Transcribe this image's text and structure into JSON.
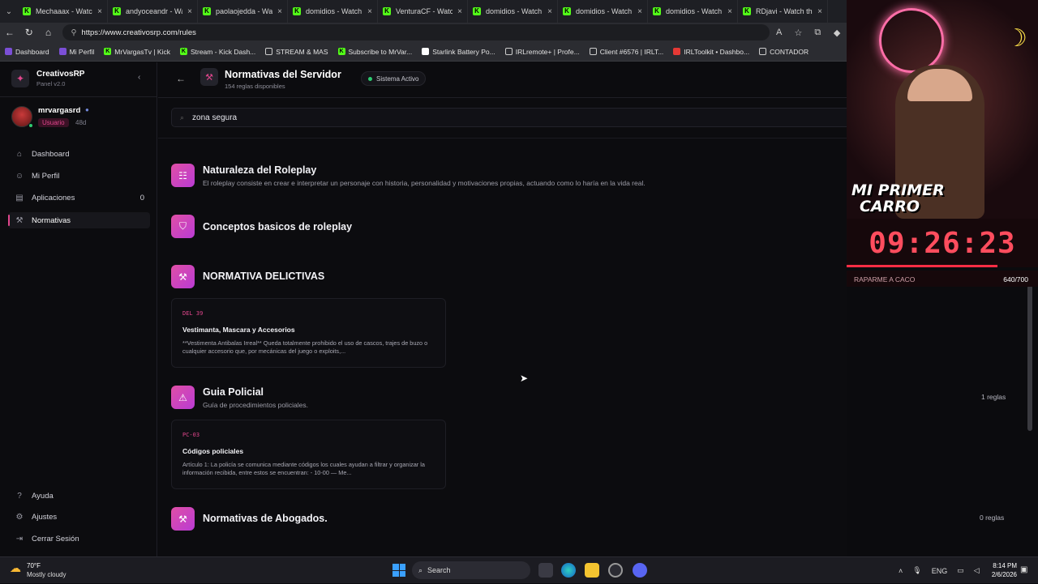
{
  "browser": {
    "tabs": [
      {
        "label": "Mechaaax - Watch t"
      },
      {
        "label": "andyoceandr - Watc"
      },
      {
        "label": "paolaojedda - Watc"
      },
      {
        "label": "domidios - Watch t"
      },
      {
        "label": "VenturaCF - Watch t"
      },
      {
        "label": "domidios - Watch t"
      },
      {
        "label": "domidios - Watch t"
      },
      {
        "label": "domidios - Watch t"
      },
      {
        "label": "RDjavi - Watch the"
      }
    ],
    "url": "https://www.creativosrp.com/rules",
    "bookmarks": [
      {
        "label": "Dashboard",
        "icon": "purple"
      },
      {
        "label": "Mi Perfil",
        "icon": "purple"
      },
      {
        "label": "MrVargasTv | Kick",
        "icon": "kick"
      },
      {
        "label": "Stream - Kick Dash...",
        "icon": "kick"
      },
      {
        "label": "STREAM & MAS",
        "icon": "folder"
      },
      {
        "label": "Subscribe to MrVar...",
        "icon": "kick"
      },
      {
        "label": "Starlink Battery Po...",
        "icon": "white"
      },
      {
        "label": "IRLremote+ | Profe...",
        "icon": "globe"
      },
      {
        "label": "Client #6576 | IRLT...",
        "icon": "folder"
      },
      {
        "label": "IRLToolkit • Dashbo...",
        "icon": "red"
      },
      {
        "label": "CONTADOR",
        "icon": "globe"
      }
    ]
  },
  "sidebar": {
    "brand": "CreativosRP",
    "version": "Panel v2.0",
    "user": {
      "name": "mrvargasrd",
      "role": "Usuario",
      "age": "48d"
    },
    "nav": [
      {
        "label": "Dashboard",
        "icon": "home-icon",
        "count": ""
      },
      {
        "label": "Mi Perfil",
        "icon": "user-icon",
        "count": ""
      },
      {
        "label": "Aplicaciones",
        "icon": "document-icon",
        "count": "0"
      },
      {
        "label": "Normativas",
        "icon": "gavel-icon",
        "count": ""
      }
    ],
    "footer": [
      {
        "label": "Ayuda",
        "icon": "help-icon"
      },
      {
        "label": "Ajustes",
        "icon": "gear-icon"
      },
      {
        "label": "Cerrar Sesión",
        "icon": "logout-icon"
      }
    ]
  },
  "header": {
    "title": "Normativas del Servidor",
    "subtitle": "154 reglas disponibles",
    "status": "Sistema Activo"
  },
  "search": {
    "value": "zona segura"
  },
  "sections": [
    {
      "title": "Naturaleza del Roleplay",
      "desc": "El roleplay consiste en crear e interpretar un personaje con historia, personalidad y motivaciones propias, actuando como lo haría en la vida real.",
      "count": ""
    },
    {
      "title": "Conceptos basicos de roleplay",
      "desc": "",
      "count": ""
    },
    {
      "title": "NORMATIVA DELICTIVAS",
      "desc": "",
      "count": ""
    },
    {
      "title": "Guia Policial",
      "desc": "Guía de procedimientos policiales.",
      "count": "1 reglas"
    },
    {
      "title": "Normativas de Abogados.",
      "desc": "",
      "count": "0 reglas"
    }
  ],
  "cards": [
    {
      "code": "DEL 39",
      "title": "Vestimanta, Mascara y Accesorios",
      "body": "**Vestimenta Antibalas Irreal** Queda totalmente prohibido el uso de cascos, trajes de buzo o cualquier accesorio que, por mecánicas del juego o exploits,..."
    },
    {
      "code": "PC-03",
      "title": "Códigos policiales",
      "body": "Artículo 1: La policía se comunica mediante códigos los cuales ayudan a filtrar y organizar la información recibida, entre estos se encuentran: - 10-00 — Me..."
    }
  ],
  "overlay": {
    "line1": "MI PRIMER",
    "line2": "CARRO",
    "timer": "09:26:23",
    "goal_label": "RAPARME A CACO",
    "goal_count": "640/700"
  },
  "taskbar": {
    "temp": "70°F",
    "weather": "Mostly cloudy",
    "search": "Search",
    "lang": "ENG",
    "time": "8:14 PM",
    "date": "2/6/2026"
  }
}
